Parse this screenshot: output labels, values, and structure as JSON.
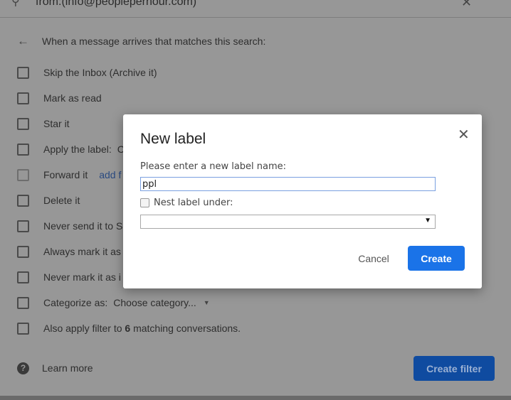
{
  "search": {
    "query": "from:(info@peopleperhour.com)"
  },
  "filter": {
    "heading": "When a message arrives that matches this search:",
    "options": [
      {
        "label": "Skip the Inbox (Archive it)"
      },
      {
        "label": "Mark as read"
      },
      {
        "label": "Star it"
      },
      {
        "label": "Apply the label:",
        "value": "C"
      },
      {
        "label": "Forward it",
        "link": "add f"
      },
      {
        "label": "Delete it"
      },
      {
        "label": "Never send it to Sp"
      },
      {
        "label": "Always mark it as"
      },
      {
        "label": "Never mark it as i"
      },
      {
        "label": "Categorize as:",
        "dropdown": "Choose category..."
      }
    ],
    "apply_prefix": "Also apply filter to ",
    "apply_count": "6",
    "apply_suffix": " matching conversations.",
    "learn_more": "Learn more",
    "create_filter": "Create filter"
  },
  "dialog": {
    "title": "New label",
    "prompt": "Please enter a new label name:",
    "label_value": "ppl",
    "nest_label": "Nest label under:",
    "nest_value": "",
    "cancel": "Cancel",
    "create": "Create"
  },
  "colors": {
    "accent": "#1a73e8",
    "overlay": "#979797"
  }
}
